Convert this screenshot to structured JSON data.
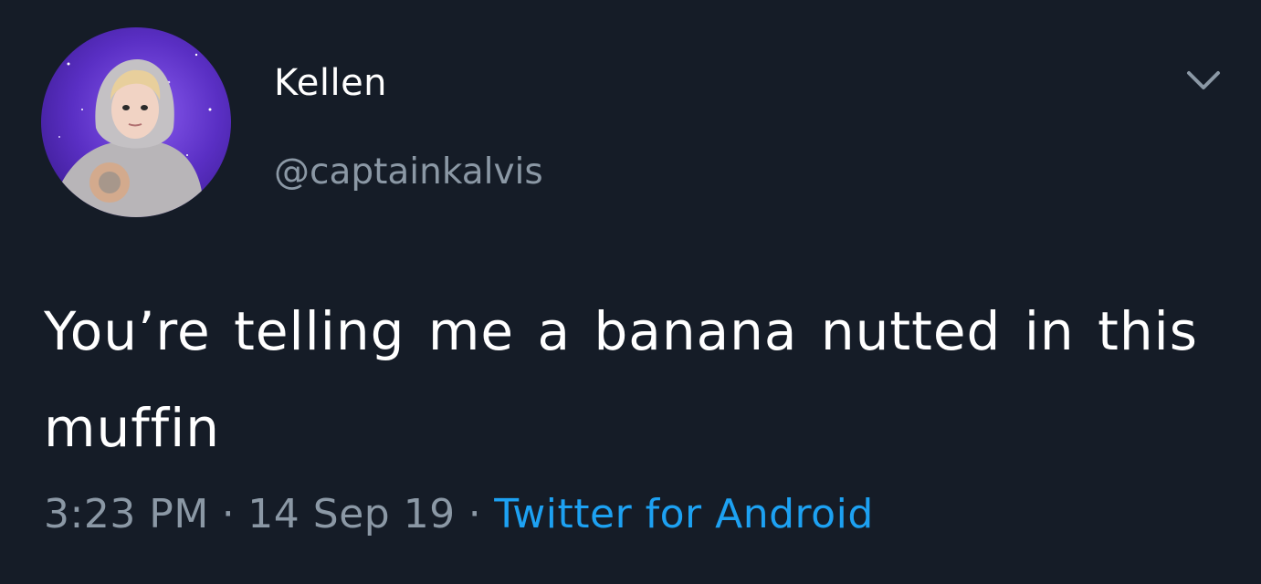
{
  "tweet": {
    "author": {
      "display_name": "Kellen",
      "handle": "@captainkalvis",
      "avatar_icon": "user-avatar"
    },
    "menu_icon": "chevron-down-icon",
    "text": "You’re telling me a banana nutted in this muffin",
    "time": "3:23 PM",
    "date": "14 Sep 19",
    "separator": "·",
    "source": "Twitter for Android"
  },
  "colors": {
    "background": "#151c27",
    "primary_text": "#ffffff",
    "secondary_text": "#8b98a5",
    "link": "#1da1f2",
    "avatar_bg": "#5a2fc4"
  }
}
